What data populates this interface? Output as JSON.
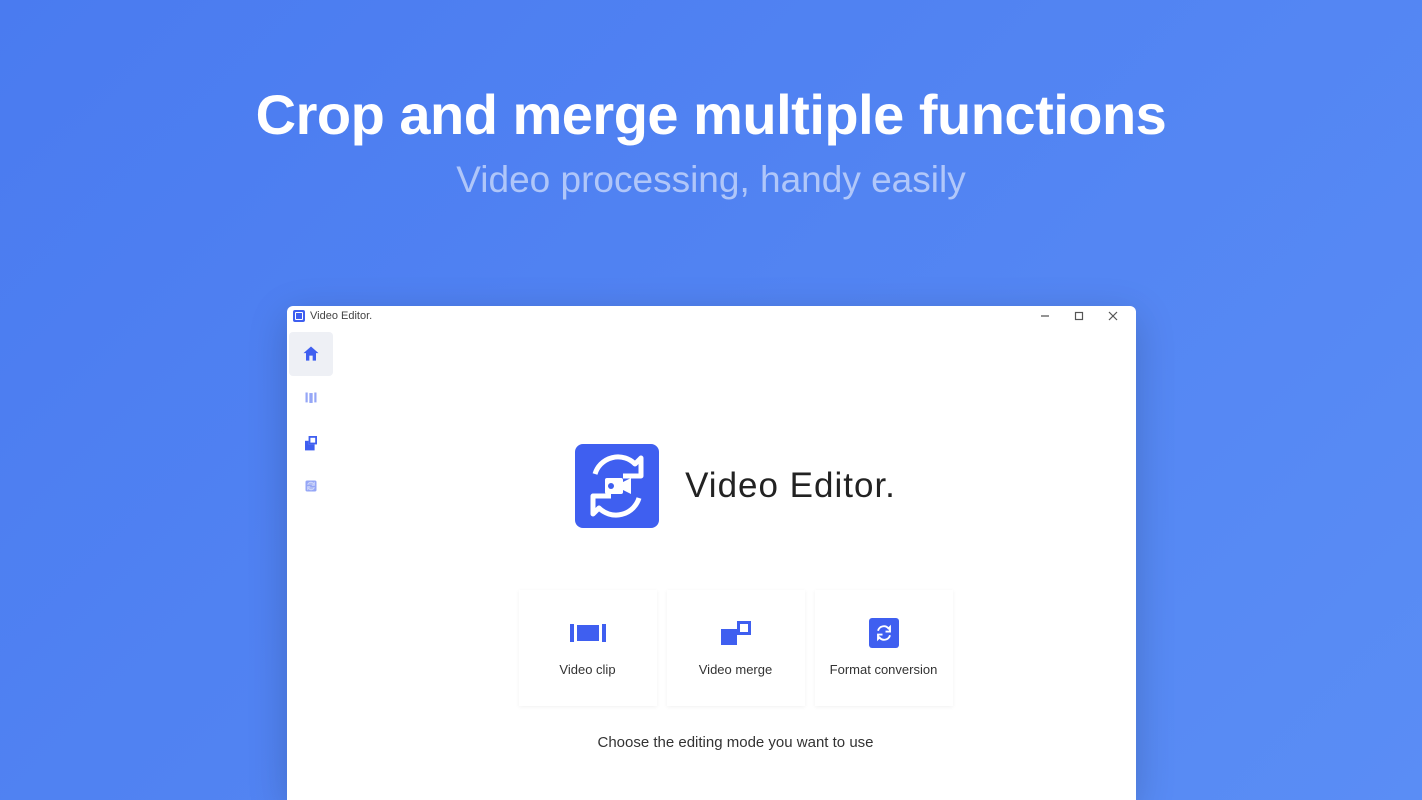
{
  "hero": {
    "title": "Crop and merge multiple functions",
    "subtitle": "Video processing, handy easily"
  },
  "window": {
    "title": "Video Editor."
  },
  "app": {
    "name": "Video Editor.",
    "helperText": "Choose the editing mode you want to use"
  },
  "sidebar": {
    "items": [
      {
        "name": "home",
        "active": true
      },
      {
        "name": "clip",
        "active": false
      },
      {
        "name": "merge",
        "active": false
      },
      {
        "name": "convert",
        "active": false
      }
    ]
  },
  "cards": [
    {
      "label": "Video clip"
    },
    {
      "label": "Video merge"
    },
    {
      "label": "Format conversion"
    }
  ],
  "colors": {
    "accent": "#3f5ff0"
  }
}
